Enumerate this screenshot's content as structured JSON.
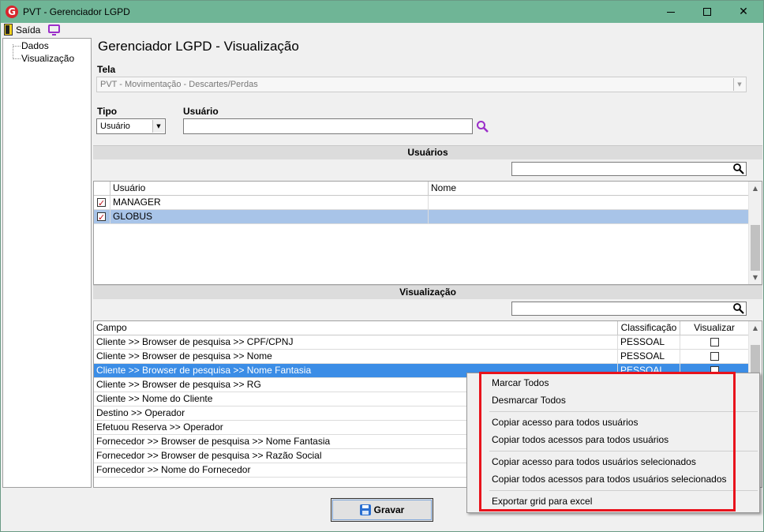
{
  "window": {
    "title": "PVT - Gerenciador LGPD",
    "logo_letter": "G"
  },
  "toolbar": {
    "exit_label": "Saída"
  },
  "tree": {
    "items": [
      {
        "label": "Dados"
      },
      {
        "label": "Visualização"
      }
    ]
  },
  "page": {
    "title": "Gerenciador LGPD - Visualização"
  },
  "form": {
    "tela_label": "Tela",
    "tela_value": "PVT - Movimentação  - Descartes/Perdas",
    "tipo_label": "Tipo",
    "tipo_value": "Usuário",
    "usuario_label": "Usuário",
    "usuario_value": ""
  },
  "usuarios_section": {
    "header": "Usuários",
    "search_value": "",
    "columns": [
      "Usuário",
      "Nome"
    ],
    "rows": [
      {
        "checked": true,
        "usuario": "MANAGER",
        "nome": "",
        "selected": false
      },
      {
        "checked": true,
        "usuario": "GLOBUS",
        "nome": "",
        "selected": true
      }
    ]
  },
  "visualizacao_section": {
    "header": "Visualização",
    "search_value": "",
    "columns": [
      "Campo",
      "Classificação",
      "Visualizar"
    ],
    "rows": [
      {
        "campo": "Cliente >> Browser de pesquisa >> CPF/CPNJ",
        "classificacao": "PESSOAL",
        "visualizar": false
      },
      {
        "campo": "Cliente >> Browser de pesquisa >> Nome",
        "classificacao": "PESSOAL",
        "visualizar": false
      },
      {
        "campo": "Cliente >> Browser de pesquisa >> Nome Fantasia",
        "classificacao": "PESSOAL",
        "visualizar": false
      },
      {
        "campo": "Cliente >> Browser de pesquisa >> RG",
        "classificacao": "",
        "visualizar": null
      },
      {
        "campo": "Cliente >> Nome do Cliente",
        "classificacao": "",
        "visualizar": null
      },
      {
        "campo": "Destino >> Operador",
        "classificacao": "",
        "visualizar": null
      },
      {
        "campo": "Efetuou Reserva >> Operador",
        "classificacao": "",
        "visualizar": null
      },
      {
        "campo": "Fornecedor >> Browser de pesquisa >> Nome Fantasia",
        "classificacao": "",
        "visualizar": null
      },
      {
        "campo": "Fornecedor >> Browser de pesquisa >> Razão Social",
        "classificacao": "",
        "visualizar": null
      },
      {
        "campo": "Fornecedor >> Nome do Fornecedor",
        "classificacao": "",
        "visualizar": null
      }
    ]
  },
  "save_button": {
    "label": "Gravar"
  },
  "context_menu": {
    "items": [
      "Marcar Todos",
      "Desmarcar Todos",
      "Copiar acesso para todos usuários",
      "Copiar todos acessos para todos usuários",
      "Copiar acesso para todos usuários selecionados",
      "Copiar todos acessos para todos usuários selecionados",
      "Exportar grid para excel"
    ]
  },
  "colors": {
    "titlebar": "#6fb596",
    "selection_blue": "#3b8de6",
    "selection_light": "#a8c4e8",
    "highlight_red": "#e8131c",
    "accent_purple": "#9b2ec9"
  }
}
